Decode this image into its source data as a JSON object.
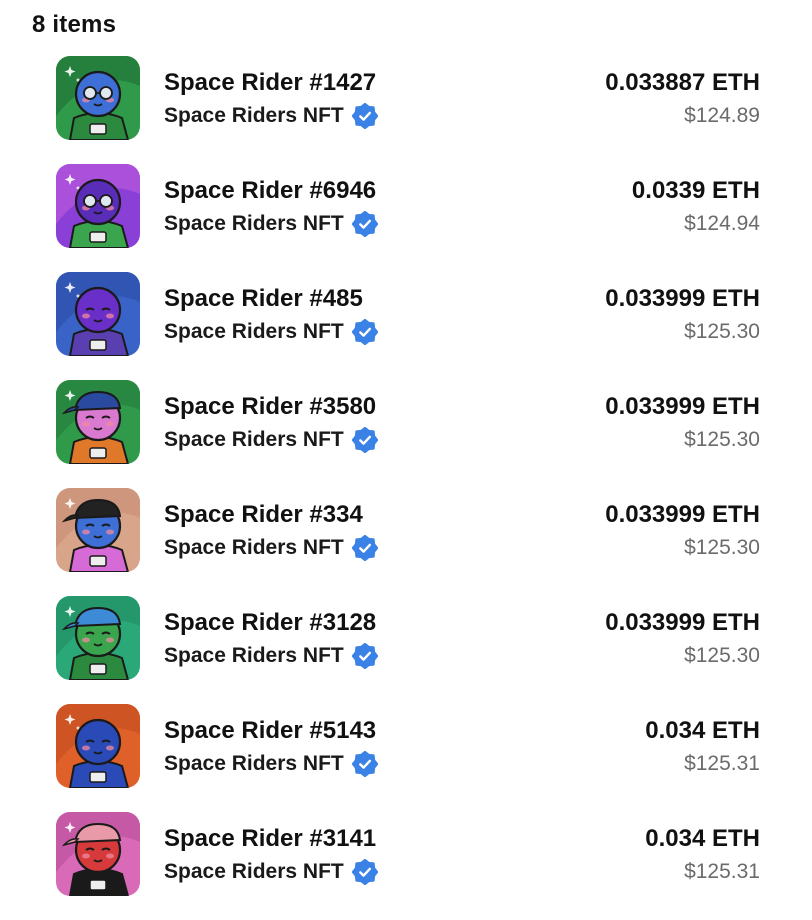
{
  "header": {
    "count_label": "8 items"
  },
  "items": [
    {
      "name": "Space Rider #1427",
      "collection": "Space Riders NFT",
      "eth": "0.033887 ETH",
      "usd": "$124.89",
      "bg": "#2f9a4a",
      "bg2": "#1e6b34",
      "head": "#3d6fd6",
      "suit": "#2c8a3e",
      "glasses": true,
      "hat": "none",
      "hatColor": ""
    },
    {
      "name": "Space Rider #6946",
      "collection": "Space Riders NFT",
      "eth": "0.0339 ETH",
      "usd": "$124.94",
      "bg": "#8a3fd6",
      "bg2": "#c45fe0",
      "head": "#5a2db8",
      "suit": "#3aa54c",
      "glasses": true,
      "hat": "none",
      "hatColor": ""
    },
    {
      "name": "Space Rider #485",
      "collection": "Space Riders NFT",
      "eth": "0.033999 ETH",
      "usd": "$125.30",
      "bg": "#3a63c8",
      "bg2": "#2a4aa0",
      "head": "#6a2fc8",
      "suit": "#5a3fb0",
      "glasses": false,
      "hat": "none",
      "hatColor": ""
    },
    {
      "name": "Space Rider #3580",
      "collection": "Space Riders NFT",
      "eth": "0.033999 ETH",
      "usd": "$125.30",
      "bg": "#2f9a4a",
      "bg2": "#237a3a",
      "head": "#d97ad0",
      "suit": "#e0782a",
      "glasses": false,
      "hat": "cap",
      "hatColor": "#2a4aa0"
    },
    {
      "name": "Space Rider #334",
      "collection": "Space Riders NFT",
      "eth": "0.033999 ETH",
      "usd": "$125.30",
      "bg": "#d8a48a",
      "bg2": "#c68a72",
      "head": "#3d6fd6",
      "suit": "#d66ad6",
      "glasses": false,
      "hat": "cap",
      "hatColor": "#222222"
    },
    {
      "name": "Space Rider #3128",
      "collection": "Space Riders NFT",
      "eth": "0.033999 ETH",
      "usd": "$125.30",
      "bg": "#2aa878",
      "bg2": "#1f8a5e",
      "head": "#3aa54c",
      "suit": "#2c8a3e",
      "glasses": false,
      "hat": "cap",
      "hatColor": "#3d8ad6"
    },
    {
      "name": "Space Rider #5143",
      "collection": "Space Riders NFT",
      "eth": "0.034 ETH",
      "usd": "$125.31",
      "bg": "#e0602a",
      "bg2": "#c04a1e",
      "head": "#2a4ab8",
      "suit": "#2a4ab8",
      "glasses": false,
      "hat": "none",
      "hatColor": ""
    },
    {
      "name": "Space Rider #3141",
      "collection": "Space Riders NFT",
      "eth": "0.034 ETH",
      "usd": "$125.31",
      "bg": "#d86ab8",
      "bg2": "#b84a98",
      "head": "#d63a3a",
      "suit": "#1a1a1a",
      "glasses": false,
      "hat": "cap",
      "hatColor": "#e89aa8"
    }
  ],
  "icons": {
    "verified": "verified-badge-icon"
  },
  "colors": {
    "verified": "#3b82e6"
  }
}
